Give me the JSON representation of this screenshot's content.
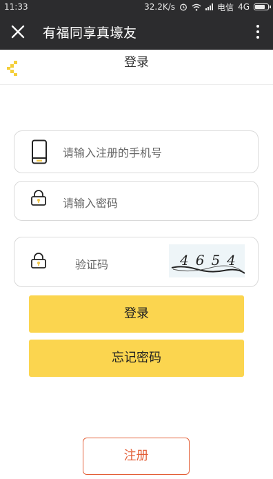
{
  "status_bar": {
    "time": "11:33",
    "speed": "32.2K/s",
    "carrier": "电信",
    "network": "4G"
  },
  "title_bar": {
    "title": "有福同享真壕友"
  },
  "page": {
    "title": "登录"
  },
  "form": {
    "phone_placeholder": "请输入注册的手机号",
    "password_placeholder": "请输入密码",
    "code_placeholder": "验证码",
    "captcha_text": "4654"
  },
  "buttons": {
    "login": "登录",
    "forgot": "忘记密码",
    "register": "注册"
  },
  "colors": {
    "accent_yellow": "#fbd54f",
    "register_red": "#e35e36",
    "title_bar_bg": "#2c2c2e"
  }
}
